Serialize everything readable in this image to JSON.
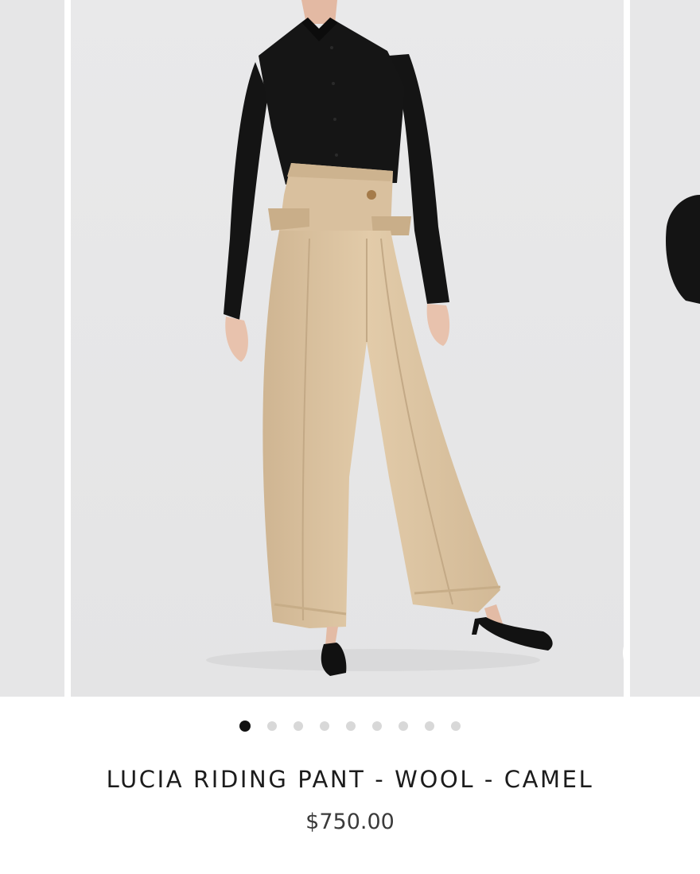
{
  "gallery": {
    "main_image_alt": "Model wearing camel wide-leg high-waisted riding pant with black silk shirt and black slingback heels",
    "zoom": {
      "icon": "magnifier-icon"
    },
    "slide_count": 9,
    "active_slide": 1
  },
  "product": {
    "title": "LUCIA RIDING PANT - WOOL - CAMEL",
    "price": "$750.00"
  },
  "colors": {
    "background_studio": "#e8e8e9",
    "pant_camel": "#dcc4a3",
    "shirt_black": "#141414",
    "dot_active": "#111111",
    "dot_inactive": "#d8d8d8"
  }
}
